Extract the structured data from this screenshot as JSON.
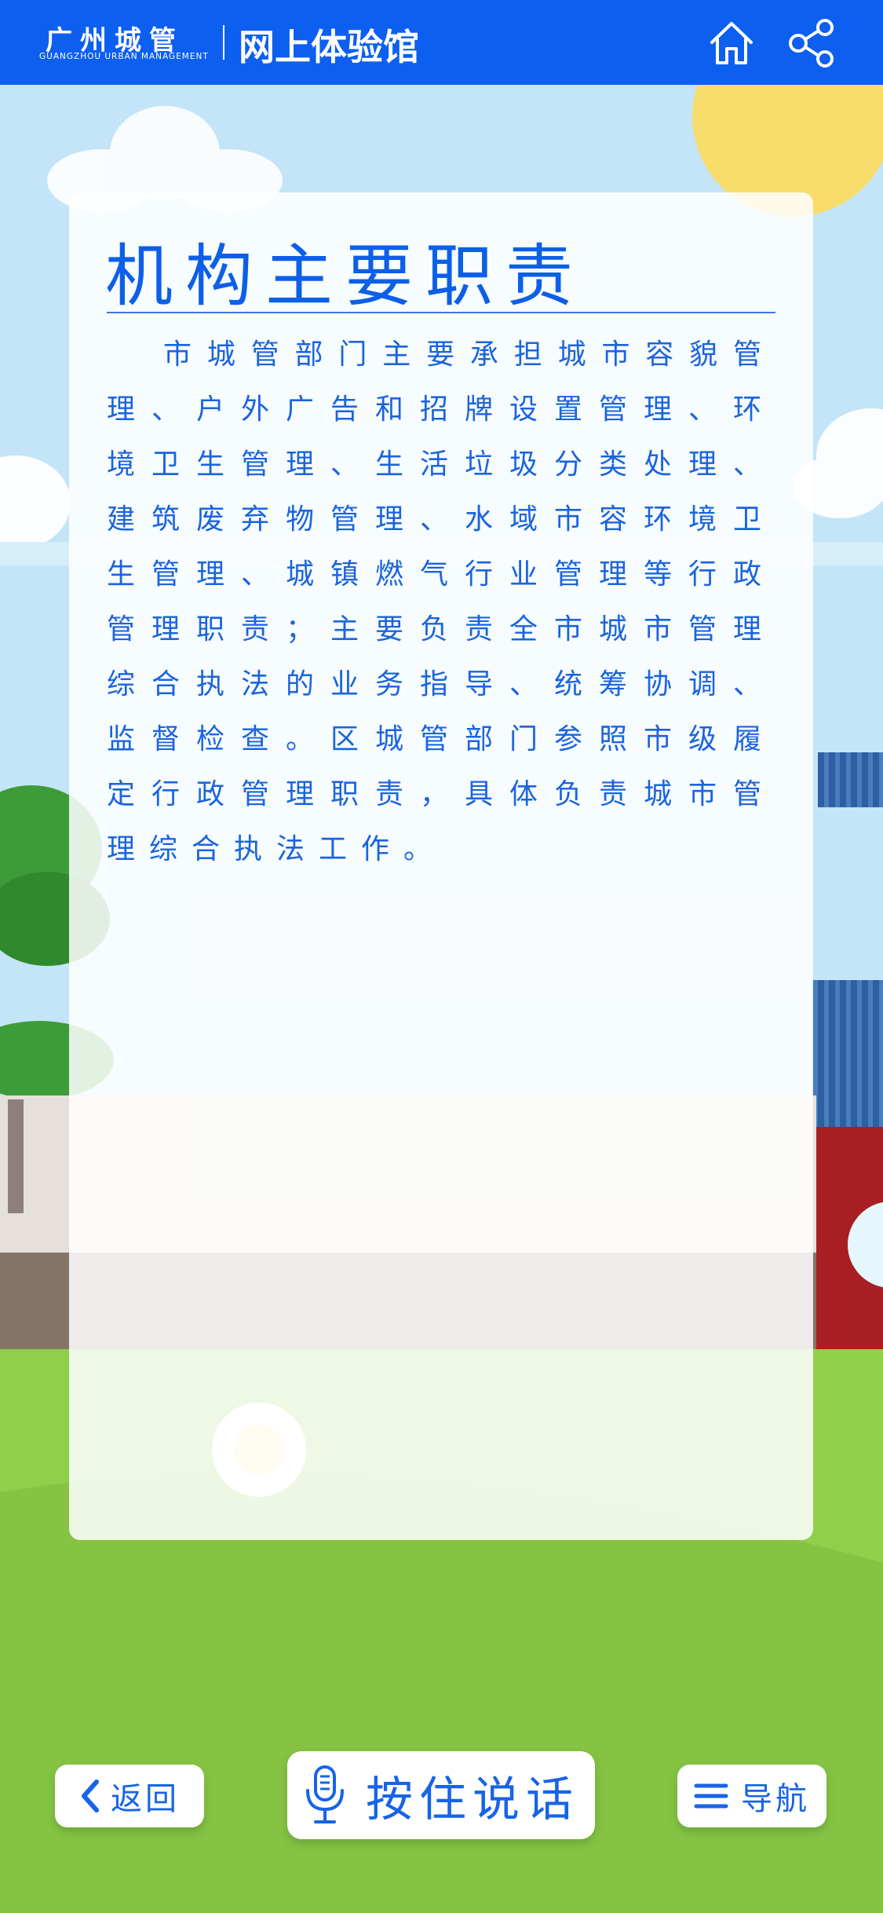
{
  "header": {
    "logo_cn": "广州城管",
    "logo_en": "GUANGZHOU URBAN MANAGEMENT",
    "title": "网上体验馆",
    "home_icon": "home-icon",
    "share_icon": "share-icon",
    "accent_color": "#0d5ff0"
  },
  "card": {
    "title": "机构主要职责",
    "body": "市城管部门主要承担城市容貌管理、户外广告和招牌设置管理、环境卫生管理、生活垃圾分类处理、建筑废弃物管理、水域市容环境卫生管理、城镇燃气行业管理等行政管理职责；主要负责全市城市管理综合执法的业务指导、统筹协调、监督检查。区城管部门参照市级履定行政管理职责，具体负责城市管理综合执法工作。",
    "text_color": "#1a64de"
  },
  "buttons": {
    "back": {
      "label": "返回",
      "icon": "chevron-left-icon"
    },
    "speak": {
      "label": "按住说话",
      "icon": "microphone-icon"
    },
    "nav": {
      "label": "导航",
      "icon": "menu-icon"
    }
  }
}
